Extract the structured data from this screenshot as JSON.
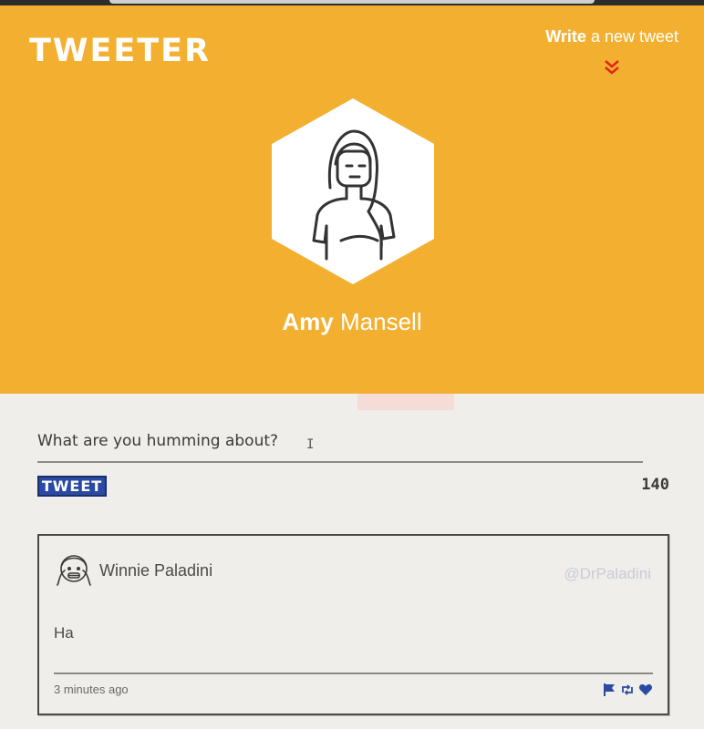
{
  "header": {
    "logo": "TWEETER",
    "compose_link": {
      "strong": "Write",
      "rest": " a new tweet"
    },
    "compose_icon": "double-chevron-down-icon",
    "profile": {
      "first_name": "Amy",
      "last_name": "Mansell",
      "avatar_icon": "woman-avatar-icon"
    }
  },
  "composer": {
    "placeholder": "What are you humming about?",
    "button_label": "TWEET",
    "char_count": "140"
  },
  "tweets": [
    {
      "author": "Winnie Paladini",
      "handle": "@DrPaladini",
      "text": "Ha",
      "time": "3 minutes ago",
      "avatar_icon": "girl-avatar-icon",
      "actions": [
        "flag-icon",
        "retweet-icon",
        "heart-icon"
      ]
    }
  ],
  "colors": {
    "header_bg": "#f3b030",
    "page_bg": "#f0eeea",
    "button_bg": "#2a4aa3",
    "action_icons": "#2a4aa3",
    "chevron": "#e0241b"
  }
}
